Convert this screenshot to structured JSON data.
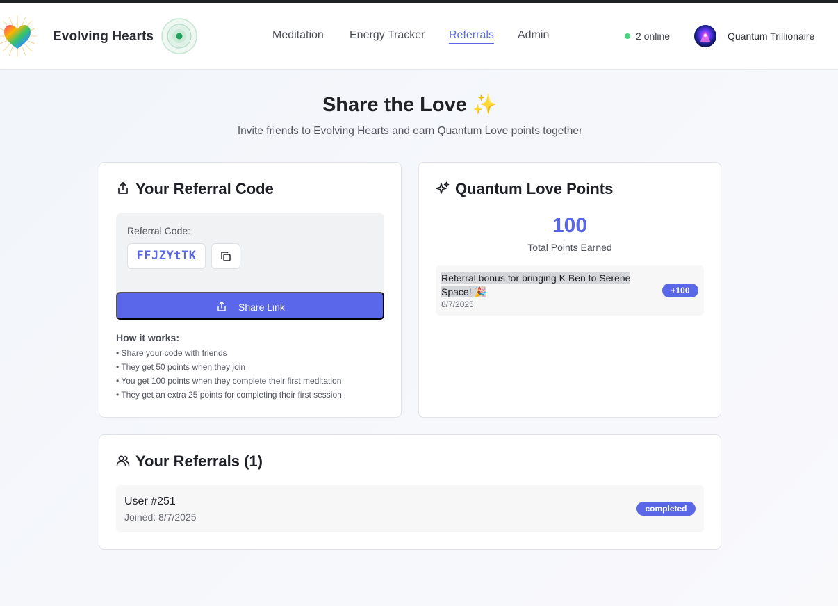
{
  "app": {
    "brand": "Evolving Hearts"
  },
  "nav": {
    "items": [
      {
        "label": "Meditation",
        "active": false
      },
      {
        "label": "Energy Tracker",
        "active": false
      },
      {
        "label": "Referrals",
        "active": true
      },
      {
        "label": "Admin",
        "active": false
      }
    ]
  },
  "status": {
    "online_text": "2 online",
    "online_color": "#48d37c"
  },
  "user": {
    "name": "Quantum Trillionaire",
    "avatar_icon": "cosmic-avatar"
  },
  "page": {
    "title": "Share the Love ✨",
    "subtitle": "Invite friends to Evolving Hearts and earn Quantum Love points together"
  },
  "referral_card": {
    "title": "Your Referral Code",
    "icon": "share-icon",
    "code_label": "Referral Code:",
    "code": "FFJZYtTK",
    "copy_icon": "copy-icon",
    "share_label": "Share Link",
    "how_title": "How it works:",
    "how_items": [
      "• Share your code with friends",
      "• They get 50 points when they join",
      "• You get 100 points when they complete their first meditation",
      "• They get an extra 25 points for completing their first session"
    ]
  },
  "points_card": {
    "title": "Quantum Love Points",
    "icon": "sparkles-icon",
    "total": "100",
    "total_label": "Total Points Earned",
    "transactions": [
      {
        "description": "Referral bonus for bringing K Ben to Serene Space! 🎉",
        "date": "8/7/2025",
        "amount": "+100"
      }
    ]
  },
  "referrals_card": {
    "title": "Your Referrals (1)",
    "icon": "users-icon",
    "items": [
      {
        "name": "User #251",
        "joined": "Joined: 8/7/2025",
        "status": "completed"
      }
    ]
  },
  "colors": {
    "accent": "#5a67e6",
    "button": "#5a67ea",
    "background": "#f3f6fa"
  }
}
